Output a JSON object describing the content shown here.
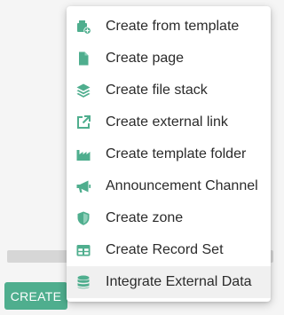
{
  "colors": {
    "accent": "#4fae8e",
    "menu_bg": "#ffffff",
    "hover_bg": "#f0f0f0",
    "page_bg": "#f5f5f5",
    "text": "#2b2b2b"
  },
  "create_button": {
    "label": "CREATE"
  },
  "menu": {
    "items": [
      {
        "label": "Create from template",
        "icon": "template-add-icon"
      },
      {
        "label": "Create page",
        "icon": "page-icon"
      },
      {
        "label": "Create file stack",
        "icon": "layers-icon"
      },
      {
        "label": "Create external link",
        "icon": "external-link-icon"
      },
      {
        "label": "Create template folder",
        "icon": "factory-icon"
      },
      {
        "label": "Announcement Channel",
        "icon": "megaphone-icon"
      },
      {
        "label": "Create zone",
        "icon": "shield-icon"
      },
      {
        "label": "Create Record Set",
        "icon": "table-icon"
      },
      {
        "label": "Integrate External Data",
        "icon": "database-icon",
        "hovered": true
      }
    ]
  }
}
